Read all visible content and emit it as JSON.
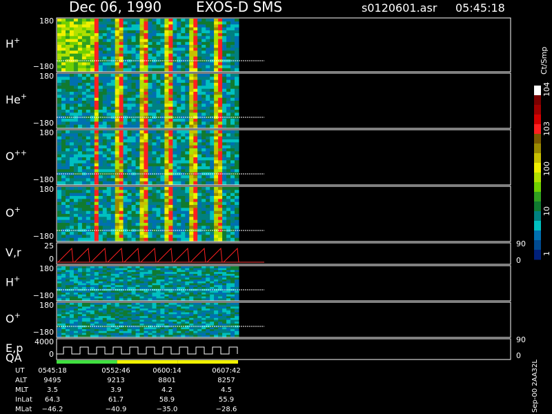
{
  "header": {
    "date": "Dec 06, 1990",
    "instrument": "EXOS-D SMS",
    "file": "s0120601.asr",
    "time": "05:45:18"
  },
  "colorbar": {
    "unit": "Ct/Smp",
    "labels": [
      "10^4",
      "10^3",
      "100",
      "10",
      "1"
    ],
    "colors": [
      "#ffffff",
      "#7a0000",
      "#a00000",
      "#d40000",
      "#ff2020",
      "#7a5a00",
      "#9a8a00",
      "#c8c000",
      "#f0f000",
      "#b0e000",
      "#70d000",
      "#30a020",
      "#107a30",
      "#008080",
      "#00c0c0",
      "#0070b0",
      "#004a90",
      "#00207a"
    ]
  },
  "footer_code": "Sep-00 2AA32L",
  "chart_data": {
    "type": "heatmap",
    "panels": [
      {
        "name": "H",
        "sup": "+",
        "kind": "pitch-angle spectrogram",
        "ymax": "180",
        "ymin": "−180",
        "yrange": [
          -180,
          180
        ],
        "intensity_scale": "log",
        "intensity_range": [
          1,
          10000
        ]
      },
      {
        "name": "He",
        "sup": "+",
        "kind": "pitch-angle spectrogram",
        "ymax": "180",
        "ymin": "−180",
        "yrange": [
          -180,
          180
        ],
        "intensity_scale": "log",
        "intensity_range": [
          1,
          10000
        ]
      },
      {
        "name": "O",
        "sup": "++",
        "kind": "pitch-angle spectrogram",
        "ymax": "180",
        "ymin": "−180",
        "yrange": [
          -180,
          180
        ],
        "intensity_scale": "log",
        "intensity_range": [
          1,
          10000
        ]
      },
      {
        "name": "O",
        "sup": "+",
        "kind": "pitch-angle spectrogram",
        "ymax": "180",
        "ymin": "−180",
        "yrange": [
          -180,
          180
        ],
        "intensity_scale": "log",
        "intensity_range": [
          1,
          10000
        ]
      },
      {
        "name": "V,r",
        "sup": "",
        "kind": "line",
        "ymax": "25",
        "ymin": "0",
        "right_top": "90",
        "right_bottom": "0"
      },
      {
        "name": "H",
        "sup": "+",
        "kind": "pitch-angle spectrogram",
        "ymax": "180",
        "ymin": "−180",
        "yrange": [
          -180,
          180
        ]
      },
      {
        "name": "O",
        "sup": "+",
        "kind": "pitch-angle spectrogram",
        "ymax": "180",
        "ymin": "−180",
        "yrange": [
          -180,
          180
        ]
      },
      {
        "name": "E,p",
        "sub": "QA",
        "kind": "line",
        "ymax": "4000",
        "ymin": "0",
        "right_top": "90",
        "right_bottom": "0"
      }
    ],
    "quality_bar": [
      "#40e040",
      "#f0f000",
      "#f0f000"
    ],
    "ephemeris": {
      "row_labels": [
        "UT",
        "ALT",
        "MLT",
        "InLat",
        "MLat"
      ],
      "columns": [
        [
          "0545:18",
          "9495",
          "3.5",
          "64.3",
          "−46.2"
        ],
        [
          "0552:46",
          "9213",
          "3.9",
          "61.7",
          "−40.9"
        ],
        [
          "0600:14",
          "8801",
          "4.2",
          "58.9",
          "−35.0"
        ],
        [
          "0607:42",
          "8257",
          "4.5",
          "55.9",
          "−28.6"
        ]
      ]
    }
  }
}
